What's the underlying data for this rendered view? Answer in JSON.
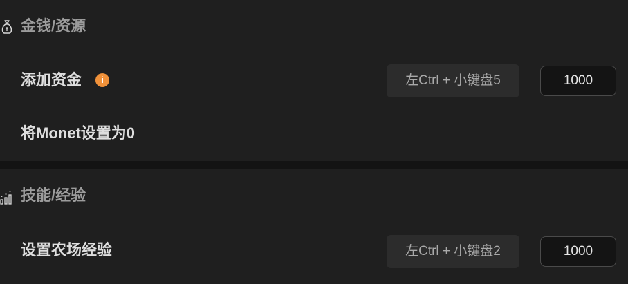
{
  "sections": [
    {
      "title": "金钱/资源",
      "icon": "money-bag-icon",
      "rows": [
        {
          "label": "添加资金",
          "has_info": true,
          "hotkey": "左Ctrl + 小键盘5",
          "value": "1000"
        },
        {
          "label": "将Monet设置为0"
        }
      ]
    },
    {
      "title": "技能/经验",
      "icon": "bar-chart-icon",
      "rows": [
        {
          "label": "设置农场经验",
          "hotkey": "左Ctrl + 小键盘2",
          "value": "1000"
        }
      ]
    }
  ],
  "info_glyph": "i",
  "colors": {
    "page_background": "#131313",
    "panel_background": "#1f1f1f",
    "info_badge": "#f0913a",
    "hotkey_background": "#2c2c2c",
    "input_background": "#141414"
  }
}
